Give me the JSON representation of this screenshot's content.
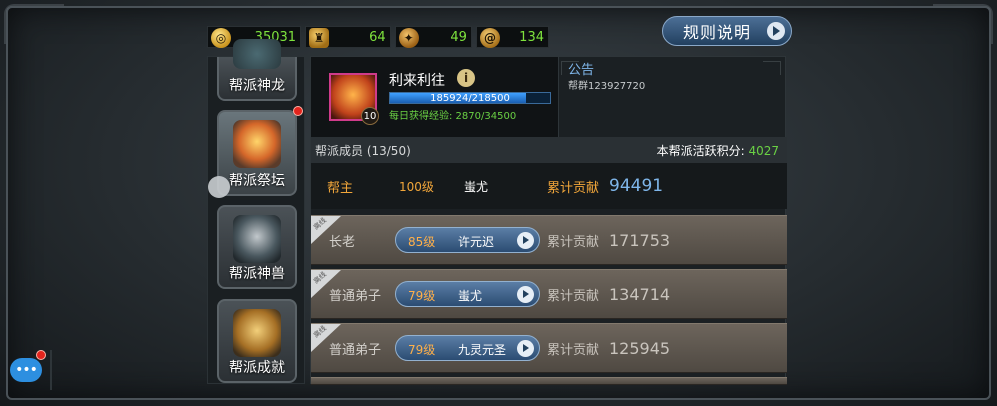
{
  "resources": [
    {
      "icon": "gold-coin-icon",
      "value": "35031"
    },
    {
      "icon": "helmet-icon",
      "value": "64"
    },
    {
      "icon": "emblem-icon",
      "value": "49"
    },
    {
      "icon": "rune-icon",
      "value": "134"
    }
  ],
  "rules_button": "规则说明",
  "nav": [
    {
      "label": "帮派神龙"
    },
    {
      "label": "帮派祭坛"
    },
    {
      "label": "帮派神兽"
    },
    {
      "label": "帮派成就"
    }
  ],
  "leader": {
    "name": "利来利往",
    "level_badge": "10",
    "exp_text": "185924/218500",
    "exp_fraction": 0.851,
    "daily_exp": "每日获得经验: 2870/34500"
  },
  "notice": {
    "title": "公告",
    "text": "帮群123927720"
  },
  "members_header": {
    "count": "帮派成员 (13/50)",
    "activity_label": "本帮派活跃积分:",
    "activity_value": "4027"
  },
  "leader_row": {
    "role": "帮主",
    "level": "100级",
    "name": "蚩尤",
    "contrib_label": "累计贡献",
    "contrib_value": "94491"
  },
  "members": [
    {
      "badge": "离线",
      "role": "长老",
      "level": "85级",
      "name": "许元迟",
      "contrib_label": "累计贡献",
      "contrib_value": "171753"
    },
    {
      "badge": "离线",
      "role": "普通弟子",
      "level": "79级",
      "name": "蚩尤",
      "contrib_label": "累计贡献",
      "contrib_value": "134714"
    },
    {
      "badge": "离线",
      "role": "普通弟子",
      "level": "79级",
      "name": "九灵元圣",
      "contrib_label": "累计贡献",
      "contrib_value": "125945"
    }
  ],
  "colors": {
    "green_value": "#7ee33d",
    "blue_value": "#7fb6ea",
    "gold_text": "#f1a63a"
  }
}
